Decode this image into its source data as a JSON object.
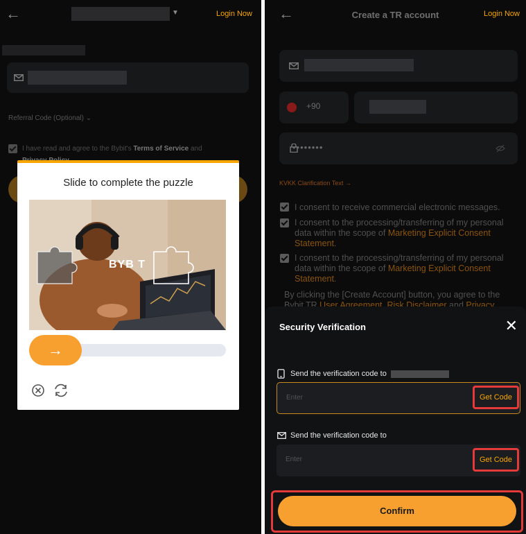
{
  "left": {
    "header": {
      "login": "Login Now"
    },
    "referral": "Referral Code (Optional)",
    "agreement": {
      "prefix": "I have read and agree to the Bybit's ",
      "tos": "Terms of Service",
      "and": " and",
      "privacy": "Privacy Policy"
    },
    "puzzle": {
      "title": "Slide to complete the puzzle",
      "watermark": "BYB T"
    }
  },
  "right": {
    "header": {
      "title": "Create a TR account",
      "login": "Login Now"
    },
    "phone_code": "+90",
    "password_mask": "••••••••",
    "kvkk": "KVKK Clarification Text",
    "consents": [
      {
        "text": "I consent to receive commercial electronic messages."
      },
      {
        "text": "I consent to the processing/transferring of my personal data within the scope of ",
        "link": "Marketing Explicit Consent Statement",
        "end": "."
      },
      {
        "text": "I consent to the processing/transferring of my personal data within the scope of ",
        "link": "Marketing Explicit Consent Statement",
        "end": "."
      }
    ],
    "byclick": {
      "prefix": "By clicking the [Create Account] button, you agree to the Bybit TR ",
      "ua": "User Agreement",
      "comma": ", ",
      "rd": "Risk Disclaimer",
      "and": " and ",
      "privacy": "Privacy"
    },
    "sheet": {
      "title": "Security Verification",
      "phone_label": "Send the verification code to",
      "email_label": "Send the verification code to",
      "placeholder": "Enter",
      "get_code": "Get Code",
      "confirm": "Confirm"
    }
  },
  "colors": {
    "accent": "#f7a600",
    "highlight": "#e53a3a",
    "background": "#0b0b0c"
  }
}
